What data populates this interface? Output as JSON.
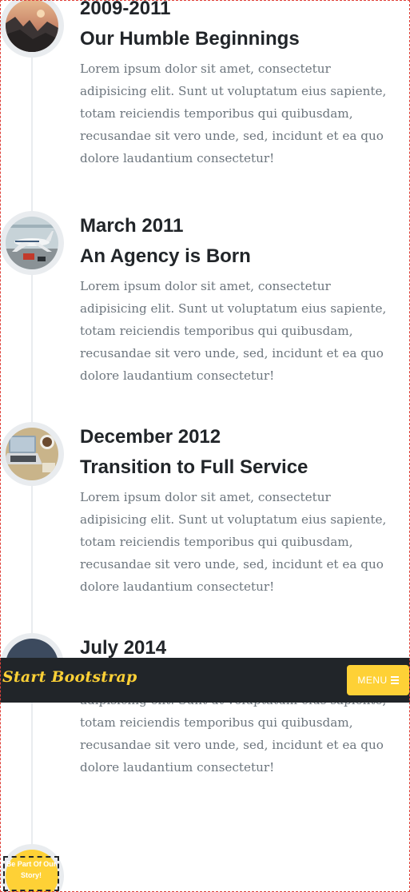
{
  "timeline": [
    {
      "date": "2009-2011",
      "heading": "Our Humble Beginnings",
      "body": "Lorem ipsum dolor sit amet, consectetur adipisicing elit. Sunt ut voluptatum eius sapiente, totam reiciendis temporibus qui quibusdam, recusandae sit vero unde, sed, incidunt et ea quo dolore laudantium consectetur!",
      "image": "mountain-sunset-photo"
    },
    {
      "date": "March 2011",
      "heading": "An Agency is Born",
      "body": "Lorem ipsum dolor sit amet, consectetur adipisicing elit. Sunt ut voluptatum eius sapiente, totam reiciendis temporibus qui quibusdam, recusandae sit vero unde, sed, incidunt et ea quo dolore laudantium consectetur!",
      "image": "airplane-photo"
    },
    {
      "date": "December 2012",
      "heading": "Transition to Full Service",
      "body": "Lorem ipsum dolor sit amet, consectetur adipisicing elit. Sunt ut voluptatum eius sapiente, totam reiciendis temporibus qui quibusdam, recusandae sit vero unde, sed, incidunt et ea quo dolore laudantium consectetur!",
      "image": "laptop-desk-photo"
    },
    {
      "date": "July 2014",
      "heading": "",
      "body": "Lorem ipsum dolor sit amet, consectetur adipisicing elit. Sunt ut voluptatum eius sapiente, totam reiciendis temporibus qui quibusdam, recusandae sit vero unde, sed, incidunt et ea quo dolore laudantium consectetur!",
      "image": "dark-photo"
    }
  ],
  "navbar": {
    "brand": "Start Bootstrap",
    "menu_label": "Menu",
    "menu_icon": "hamburger-icon"
  },
  "final_item": {
    "text": "Be Part Of Our Story!"
  },
  "colors": {
    "accent": "#fed136",
    "dark": "#212529",
    "muted": "#6c757d",
    "circle_bg": "#e9ecef"
  }
}
